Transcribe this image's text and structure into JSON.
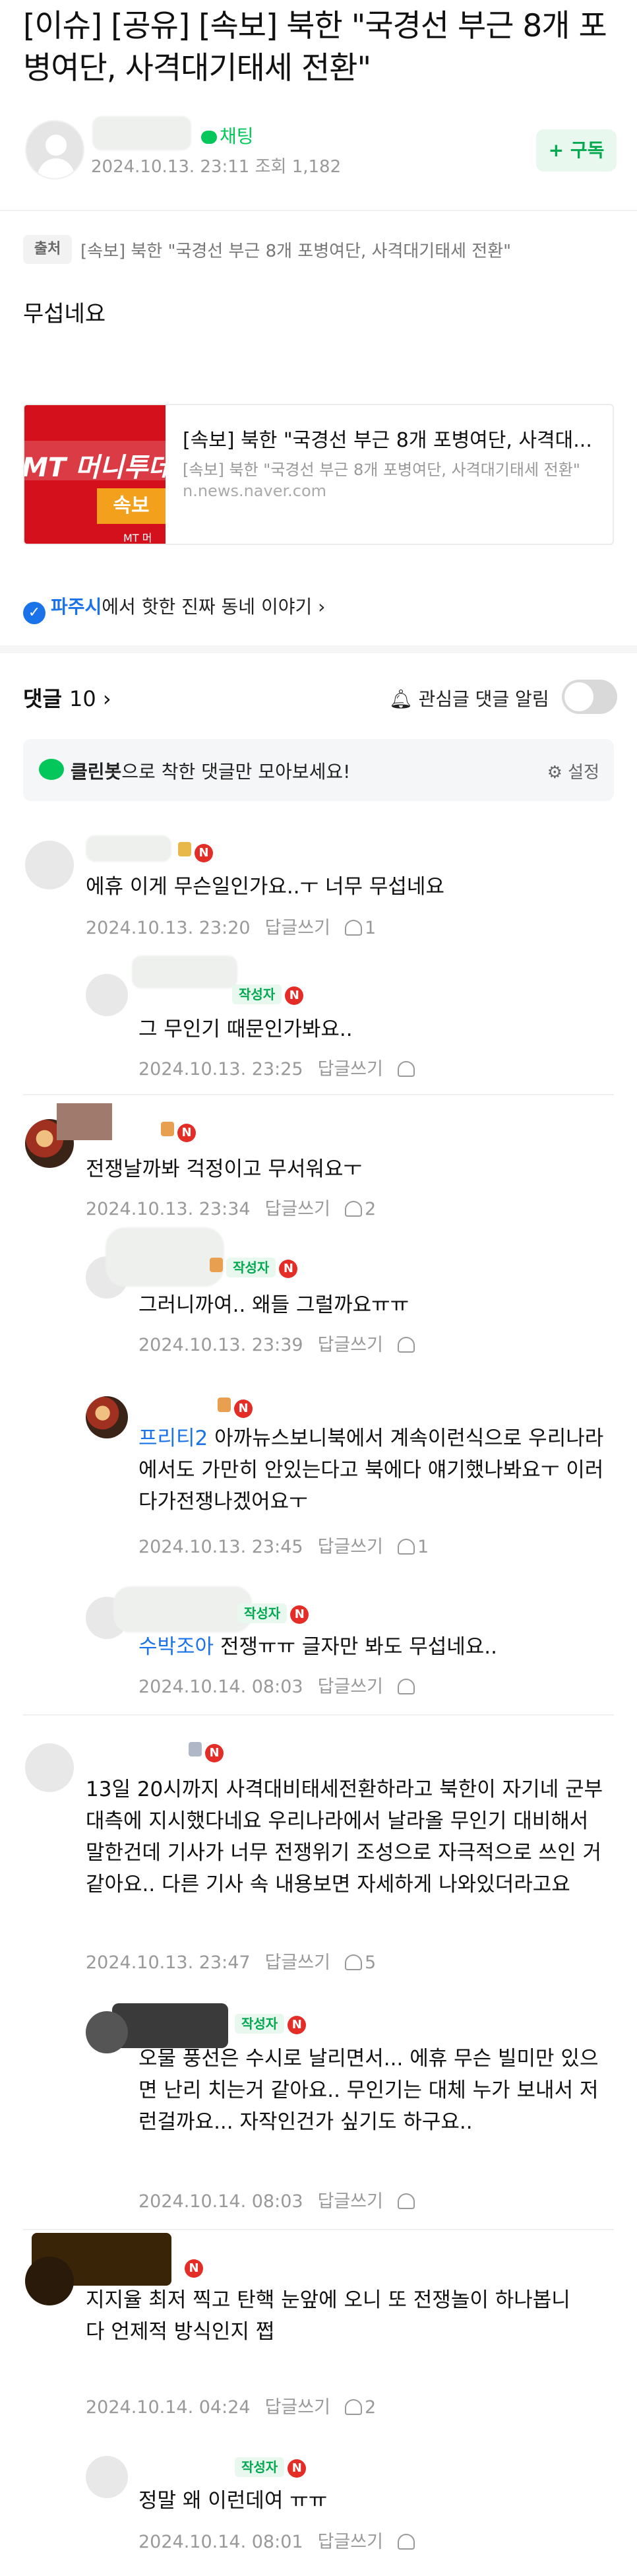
{
  "post": {
    "title": "[이슈] [공유] [속보] 북한 \"국경선 부근 8개 포병여단, 사격대기태세 전환\"",
    "chat_label": "채팅",
    "date": "2024.10.13. 23:11",
    "views": "조회 1,182",
    "subscribe_label": "+ 구독",
    "source_tag": "출처",
    "source_text": "[속보] 북한 \"국경선 부근 8개 포병여단, 사격대기태세 전환\"",
    "body": "무섭네요",
    "link": {
      "title": "[속보] 북한 \"국경선 부근 8개 포병여단, 사격대...",
      "desc": "[속보] 북한 \"국경선 부근 8개 포병여단, 사격대기태세 전환\"",
      "url": "n.news.naver.com",
      "thumb_brand": "MT 머니투데이",
      "thumb_badge": "속보",
      "thumb_small": "MT 머"
    },
    "town": {
      "city": "파주시",
      "rest": "에서 핫한 진짜 동네 이야기 ›"
    }
  },
  "comments_header": {
    "label": "댓글",
    "count": "10 ›",
    "alarm": "관심글 댓글 알림",
    "cleanbot_bold": "클린봇",
    "cleanbot_rest": "으로 착한 댓글만 모아보세요!",
    "settings": "설정"
  },
  "reply_label": "답글쓰기",
  "writer_label": "작성자",
  "comments": [
    {
      "text": "에휴 이게 무슨일인가요..ㅜ 너무 무섭네요",
      "date": "2024.10.13. 23:20",
      "likes": "1"
    },
    {
      "text": "그 무인기 때문인가봐요..",
      "date": "2024.10.13. 23:25",
      "likes": ""
    },
    {
      "text": "전쟁날까봐 걱정이고 무서워요ㅜ",
      "date": "2024.10.13. 23:34",
      "likes": "2"
    },
    {
      "text": "그러니까여.. 왜들 그럴까요ㅠㅠ",
      "date": "2024.10.13. 23:39",
      "likes": ""
    },
    {
      "mention": "프리티2",
      "text": " 아까뉴스보니북에서 계속이런식으로 우리나라에서도 가만히 안있는다고 북에다 얘기했나봐요ㅜ 이러다가전쟁나겠어요ㅜ",
      "date": "2024.10.13. 23:45",
      "likes": "1"
    },
    {
      "mention": "수박조아",
      "text": " 전쟁ㅠㅠ 글자만 봐도 무섭네요..",
      "date": "2024.10.14. 08:03",
      "likes": ""
    },
    {
      "text": "13일 20시까지 사격대비태세전환하라고 북한이 자기네 군부대측에 지시했다네요 우리나라에서 날라올 무인기 대비해서 말한건데 기사가 너무 전쟁위기 조성으로 자극적으로 쓰인 거 같아요.. 다른 기사 속 내용보면 자세하게 나와있더라고요",
      "date": "2024.10.13. 23:47",
      "likes": "5"
    },
    {
      "text": "오물 풍선은 수시로 날리면서... 에휴 무슨 빌미만 있으면 난리 치는거 같아요.. 무인기는 대체 누가 보내서 저런걸까요... 자작인건가 싶기도 하구요..",
      "date": "2024.10.14. 08:03",
      "likes": ""
    },
    {
      "text": "지지율 최저 찍고 탄핵 눈앞에 오니 또 전쟁놀이 하나봅니다 언제적 방식인지 쩝",
      "date": "2024.10.14. 04:24",
      "likes": "2"
    },
    {
      "text": "정말 왜 이런데여 ㅠㅠ",
      "date": "2024.10.14. 08:01",
      "likes": ""
    }
  ]
}
